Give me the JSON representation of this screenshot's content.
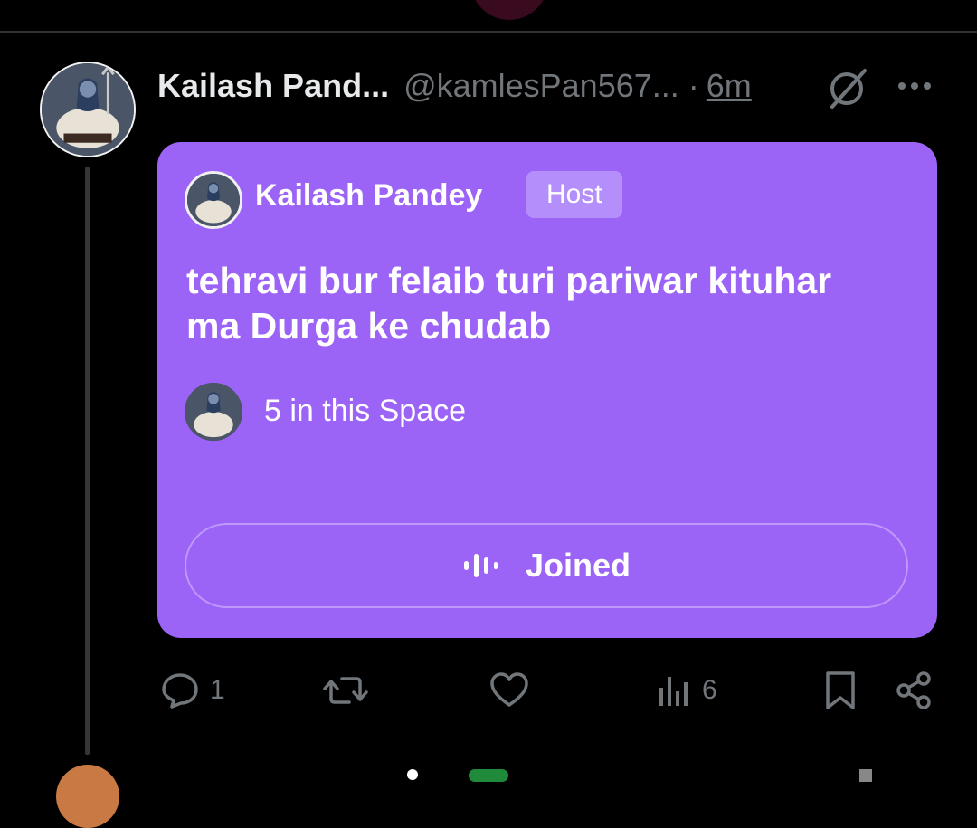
{
  "tweet": {
    "author_name": "Kailash Pand...",
    "author_handle": "@kamlesPan567...",
    "separator": "·",
    "timestamp": "6m"
  },
  "space": {
    "host_name": "Kailash Pandey",
    "host_badge": "Host",
    "title": "tehravi bur felaib turi pariwar kituhar ma Durga ke chudab",
    "listeners_text": "5 in this Space",
    "joined_label": "Joined",
    "card_color": "#9c63f7"
  },
  "actions": {
    "reply_count": "1",
    "retweet_count": "",
    "like_count": "",
    "views_count": "6"
  },
  "icons": {
    "grok": "grok-icon",
    "more": "more-icon",
    "reply": "reply-icon",
    "retweet": "retweet-icon",
    "like": "heart-icon",
    "views": "views-icon",
    "bookmark": "bookmark-icon",
    "share": "share-icon",
    "audio": "audio-wave-icon"
  }
}
